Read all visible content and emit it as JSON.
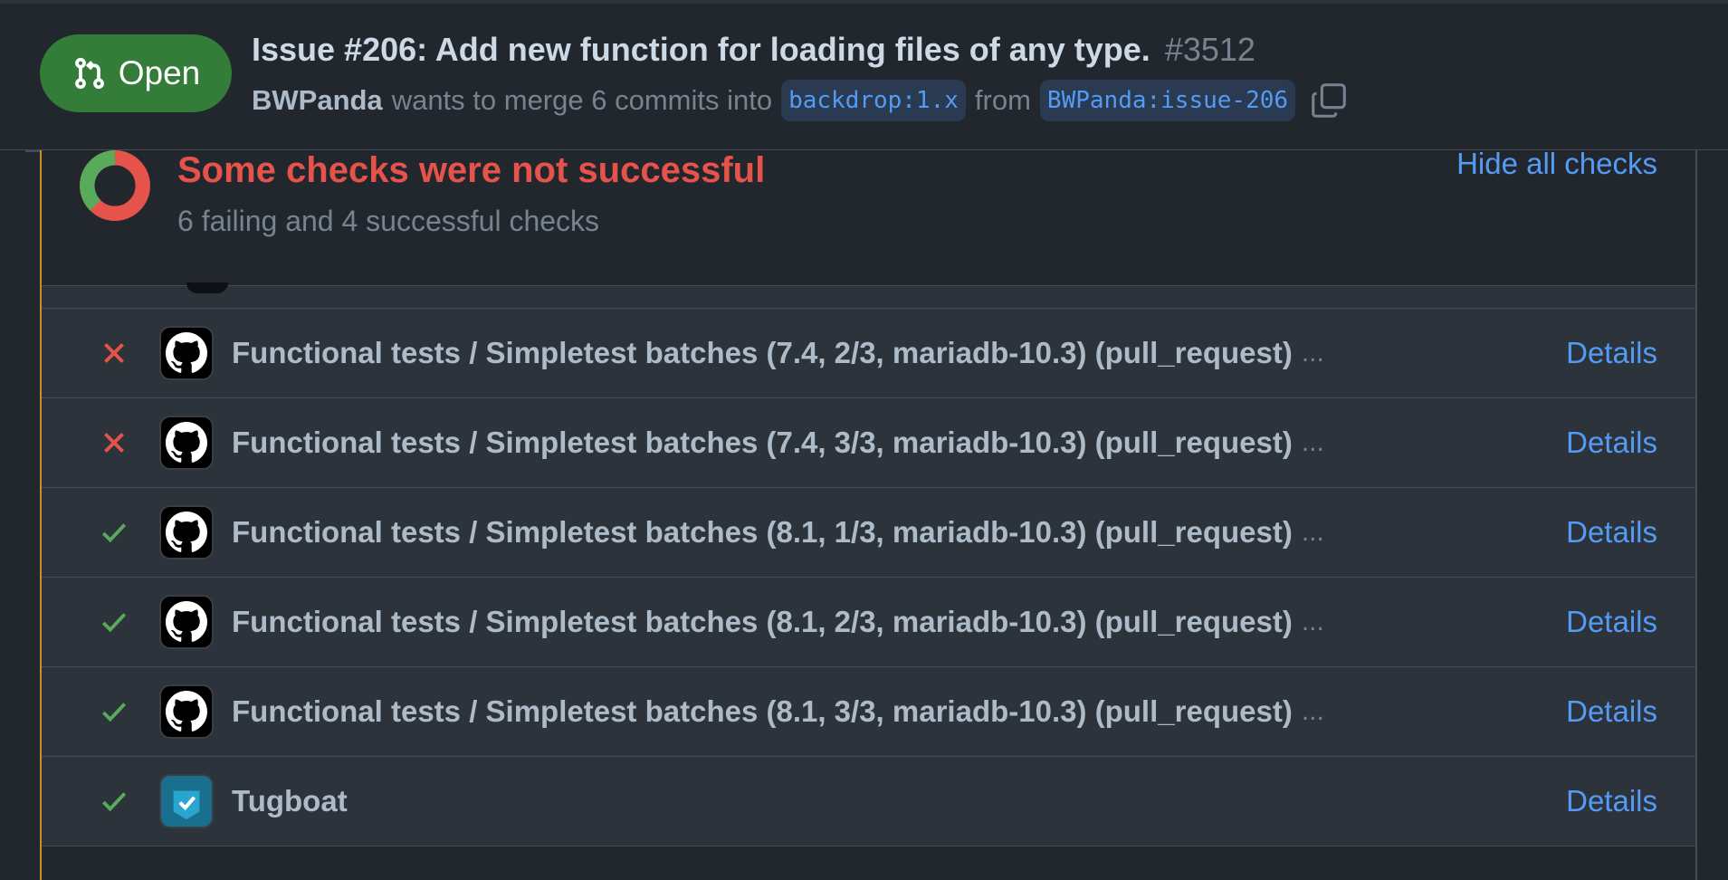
{
  "header": {
    "state_label": "Open",
    "title": "Issue #206: Add new function for loading files of any type.",
    "number": "#3512",
    "author": "BWPanda",
    "merge_text": "wants to merge 6 commits into",
    "base_branch": "backdrop:1.x",
    "from_text": "from",
    "head_branch": "BWPanda:issue-206"
  },
  "checks": {
    "summary_title": "Some checks were not successful",
    "summary_sub": "6 failing and 4 successful checks",
    "hide_label": "Hide all checks",
    "rows": [
      {
        "status": "fail",
        "icon": "github-icon",
        "name": "Functional tests / Simpletest batches (7.4, 2/3, mariadb-10.3) (pull_request)",
        "ellipsis": "...",
        "details": "Details"
      },
      {
        "status": "fail",
        "icon": "github-icon",
        "name": "Functional tests / Simpletest batches (7.4, 3/3, mariadb-10.3) (pull_request)",
        "ellipsis": "...",
        "details": "Details"
      },
      {
        "status": "pass",
        "icon": "github-icon",
        "name": "Functional tests / Simpletest batches (8.1, 1/3, mariadb-10.3) (pull_request)",
        "ellipsis": "...",
        "details": "Details"
      },
      {
        "status": "pass",
        "icon": "github-icon",
        "name": "Functional tests / Simpletest batches (8.1, 2/3, mariadb-10.3) (pull_request)",
        "ellipsis": "...",
        "details": "Details"
      },
      {
        "status": "pass",
        "icon": "github-icon",
        "name": "Functional tests / Simpletest batches (8.1, 3/3, mariadb-10.3) (pull_request)",
        "ellipsis": "...",
        "details": "Details"
      },
      {
        "status": "pass",
        "icon": "tugboat-icon",
        "name": "Tugboat",
        "ellipsis": "",
        "details": "Details"
      }
    ]
  },
  "colors": {
    "open_green": "#347d39",
    "fail_red": "#e5534b",
    "pass_green": "#57ab5a",
    "link_blue": "#539bf5"
  }
}
